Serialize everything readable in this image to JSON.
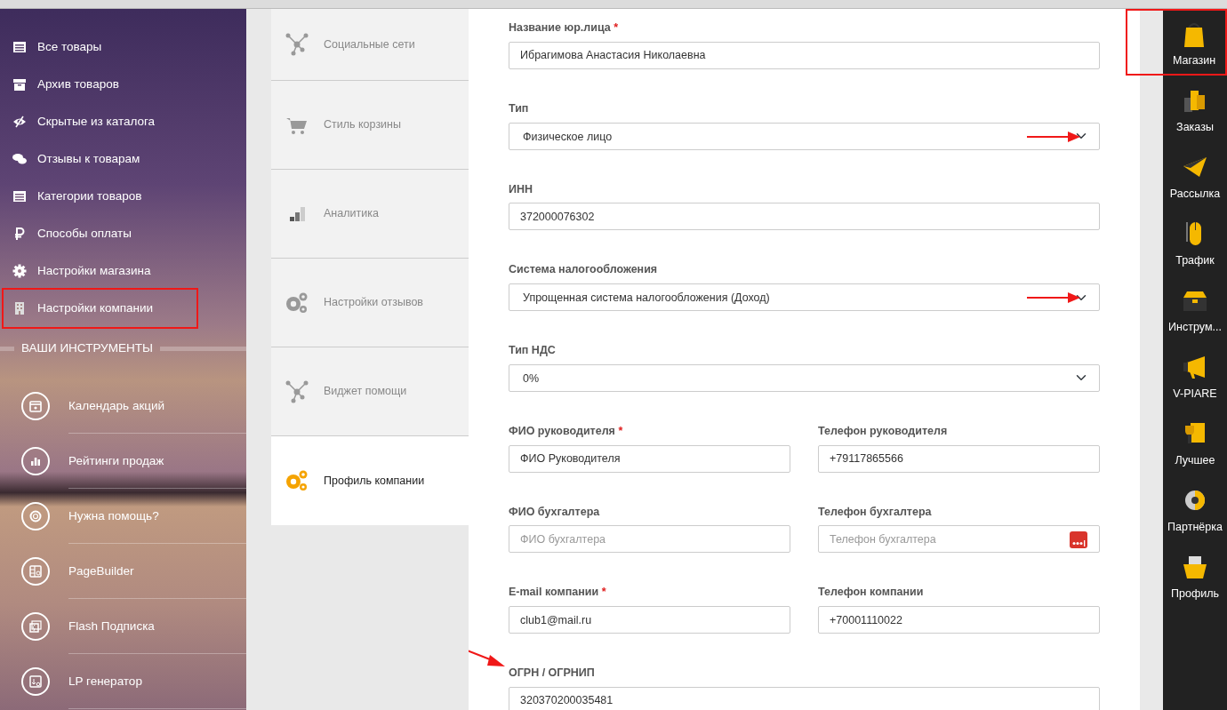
{
  "sidebar": {
    "items": [
      {
        "label": "Все товары",
        "highlighted": false
      },
      {
        "label": "Архив товаров",
        "highlighted": false
      },
      {
        "label": "Скрытые из каталога",
        "highlighted": false
      },
      {
        "label": "Отзывы к товарам",
        "highlighted": false
      },
      {
        "label": "Категории товаров",
        "highlighted": false
      },
      {
        "label": "Способы оплаты",
        "highlighted": false
      },
      {
        "label": "Настройки магазина",
        "highlighted": false
      },
      {
        "label": "Настройки компании",
        "highlighted": true
      }
    ],
    "section_title": "ВАШИ ИНСТРУМЕНТЫ",
    "tools": [
      {
        "label": "Календарь акций"
      },
      {
        "label": "Рейтинги продаж"
      },
      {
        "label": "Нужна помощь?"
      },
      {
        "label": "PageBuilder"
      },
      {
        "label": "Flash Подписка"
      },
      {
        "label": "LP генератор"
      }
    ]
  },
  "tabs": [
    {
      "label": "Социальные сети",
      "selected": false
    },
    {
      "label": "Стиль корзины",
      "selected": false
    },
    {
      "label": "Аналитика",
      "selected": false
    },
    {
      "label": "Настройки отзывов",
      "selected": false
    },
    {
      "label": "Виджет помощи",
      "selected": false
    },
    {
      "label": "Профиль компании",
      "selected": true
    }
  ],
  "form": {
    "rows": [
      [
        {
          "label": "Название юр.лица",
          "required_mark": "*",
          "kind": "input",
          "value": "Ибрагимова Анастасия Николаевна",
          "annotated": false
        }
      ],
      [
        {
          "label": "Тип",
          "kind": "select",
          "value": "Физическое лицо",
          "annotated": true
        }
      ],
      [
        {
          "label": "ИНН",
          "kind": "input",
          "value": "372000076302",
          "annotated": false
        }
      ],
      [
        {
          "label": "Система налогообложения",
          "kind": "select",
          "value": "Упрощенная система налогообложения (Доход)",
          "annotated": true
        }
      ],
      [
        {
          "label": "Тип НДС",
          "kind": "select",
          "value": "0%",
          "annotated": false
        }
      ],
      [
        {
          "label": "ФИО руководителя",
          "required_mark": "*",
          "kind": "input",
          "value": "ФИО Руководителя",
          "annotated": false
        },
        {
          "label": "Телефон руководителя",
          "kind": "input",
          "value": "+79117865566",
          "annotated": false
        }
      ],
      [
        {
          "label": "ФИО бухгалтера",
          "kind": "input",
          "placeholder": "ФИО бухгалтера",
          "annotated": false
        },
        {
          "label": "Телефон бухгалтера",
          "kind": "input",
          "placeholder": "Телефон бухгалтера",
          "autofill_button": true,
          "annotated": false
        }
      ],
      [
        {
          "label": "E-mail компании",
          "required_mark": "*",
          "kind": "input",
          "value": "club1@mail.ru",
          "annotated": false
        },
        {
          "label": "Телефон компании",
          "kind": "input",
          "value": "+70001110022",
          "annotated": false
        }
      ],
      [
        {
          "label": "ОГРН / ОГРНИП",
          "kind": "input",
          "value": "320370200035481",
          "label_annotated": true,
          "annotated": false
        }
      ]
    ]
  },
  "dock": {
    "items": [
      {
        "label": "Магазин",
        "highlighted": true
      },
      {
        "label": "Заказы",
        "highlighted": false
      },
      {
        "label": "Рассылка",
        "highlighted": false
      },
      {
        "label": "Трафик",
        "highlighted": false
      },
      {
        "label": "Инструм...",
        "highlighted": false
      },
      {
        "label": "V-PIARE",
        "highlighted": false
      },
      {
        "label": "Лучшее",
        "highlighted": false
      },
      {
        "label": "Партнёрка",
        "highlighted": false
      },
      {
        "label": "Профиль",
        "highlighted": false
      }
    ]
  }
}
